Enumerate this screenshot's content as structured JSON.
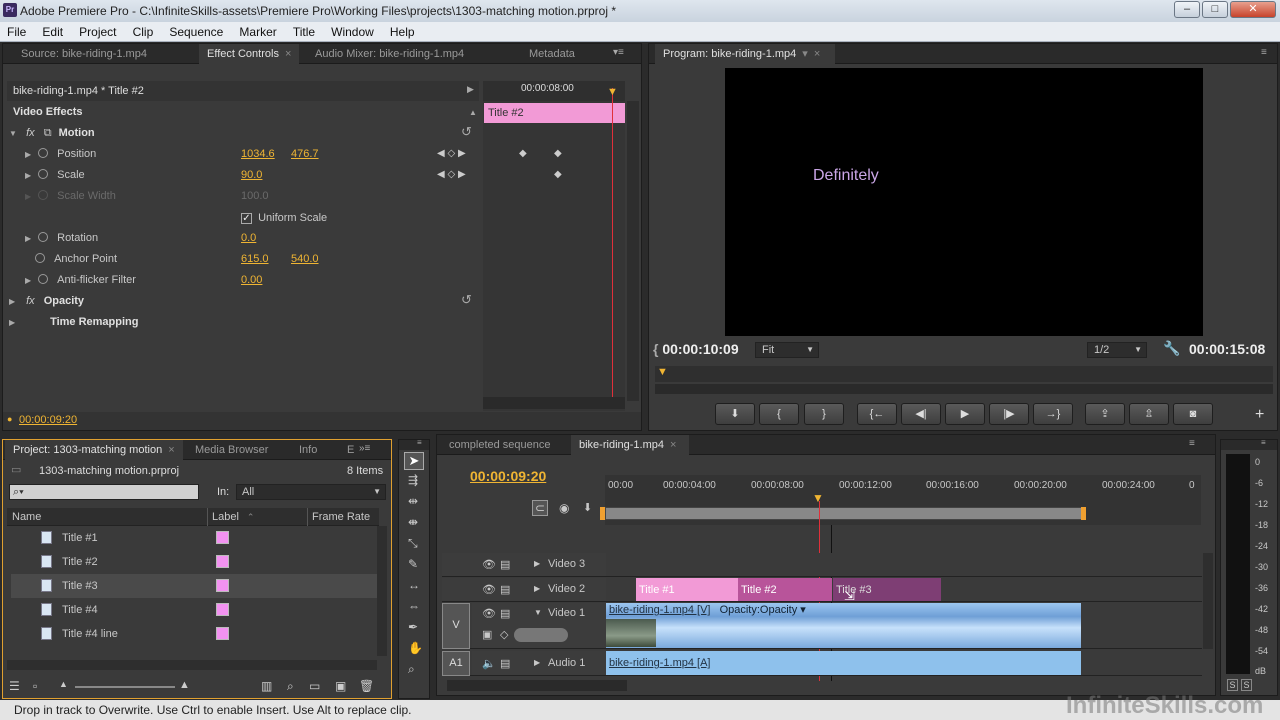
{
  "window": {
    "title": "Adobe Premiere Pro - C:\\InfiniteSkills-assets\\Premiere Pro\\Working Files\\projects\\1303-matching motion.prproj *",
    "app_badge": "Pr",
    "minimize": "–",
    "maximize": "□",
    "close": "✕"
  },
  "menu": [
    "File",
    "Edit",
    "Project",
    "Clip",
    "Sequence",
    "Marker",
    "Title",
    "Window",
    "Help"
  ],
  "top_left_panel": {
    "tabs": [
      "Source: bike-riding-1.mp4",
      "Effect Controls",
      "Audio Mixer: bike-riding-1.mp4",
      "Metadata"
    ],
    "clip_header": "bike-riding-1.mp4 * Title #2",
    "ruler_time": "00:00:08:00",
    "clip_bar_label": "Title #2",
    "section_title": "Video Effects",
    "motion": {
      "label": "Motion",
      "position_label": "Position",
      "position_x": "1034.6",
      "position_y": "476.7",
      "scale_label": "Scale",
      "scale_value": "90.0",
      "scale_width_label": "Scale Width",
      "scale_width_value": "100.0",
      "uniform_scale": "Uniform Scale",
      "rotation_label": "Rotation",
      "rotation_value": "0.0",
      "anchor_label": "Anchor Point",
      "anchor_x": "615.0",
      "anchor_y": "540.0",
      "antiflicker_label": "Anti-flicker Filter",
      "antiflicker_value": "0.00"
    },
    "opacity_label": "Opacity",
    "time_remap_label": "Time Remapping",
    "footer_time": "00:00:09:20"
  },
  "program": {
    "tab": "Program: bike-riding-1.mp4",
    "video_text": "Definitely",
    "current_time": "00:00:10:09",
    "fit": "Fit",
    "resolution": "1/2",
    "duration": "00:00:15:08"
  },
  "project": {
    "tabs": [
      "Project: 1303-matching motion",
      "Media Browser",
      "Info",
      "E"
    ],
    "filename": "1303-matching motion.prproj",
    "items_count": "8 Items",
    "in_label": "In:",
    "in_value": "All",
    "col_name": "Name",
    "col_label": "Label",
    "col_framerate": "Frame Rate",
    "items": [
      "Title #1",
      "Title #2",
      "Title #3",
      "Title #4",
      "Title #4 line"
    ],
    "label_color": "#f292f0"
  },
  "timeline": {
    "tabs": [
      "completed sequence",
      "bike-riding-1.mp4"
    ],
    "current_time": "00:00:09:20",
    "ruler": [
      "00:00",
      "00:00:04:00",
      "00:00:08:00",
      "00:00:12:00",
      "00:00:16:00",
      "00:00:20:00",
      "00:00:24:00",
      "0"
    ],
    "tracks": {
      "video3": "Video 3",
      "video2": "Video 2",
      "video1": "Video 1",
      "audio1": "Audio 1",
      "v_target": "V",
      "a_target": "A1"
    },
    "clips": {
      "title1": "Title #1",
      "title2": "Title #2",
      "title3": "Title #3",
      "video_clip": "bike-riding-1.mp4 [V]",
      "opacity": "Opacity:Opacity",
      "audio_clip": "bike-riding-1.mp4 [A]"
    }
  },
  "meter": {
    "scale": [
      "0",
      "-6",
      "-12",
      "-18",
      "-24",
      "-30",
      "-36",
      "-42",
      "-48",
      "-54",
      "dB"
    ],
    "solo_left": "S",
    "solo_right": "S"
  },
  "status_bar": "Drop in track to Overwrite. Use Ctrl to enable Insert. Use Alt to replace clip.",
  "watermark": "InfiniteSkills.com"
}
